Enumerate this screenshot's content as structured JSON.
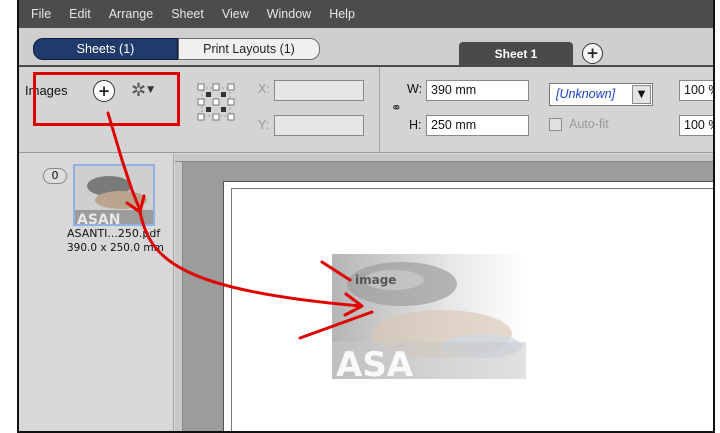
{
  "menu": [
    "File",
    "Edit",
    "Arrange",
    "Sheet",
    "View",
    "Window",
    "Help"
  ],
  "tabs": {
    "sheets": "Sheets (1)",
    "print_layouts": "Print Layouts (1)",
    "active_sheet": "Sheet 1"
  },
  "toolbar": {
    "images_label": "Images",
    "x_label": "X:",
    "y_label": "Y:",
    "x_value": "",
    "y_value": "",
    "w_label": "W:",
    "h_label": "H:",
    "w_value": "390 mm",
    "h_value": "250 mm",
    "unit_value": "[Unknown]",
    "autofit_label": "Auto-fit",
    "scale_w": "100 %",
    "scale_h": "100 %"
  },
  "image_list": {
    "count": "0",
    "filename": "ASANTI...250.pdf",
    "dimensions": "390.0 x 250.0 mm"
  },
  "canvas": {
    "image_caption": "image"
  },
  "colors": {
    "accent": "#203b6b",
    "highlight": "#e00000",
    "menubar": "#4c4c4c"
  }
}
